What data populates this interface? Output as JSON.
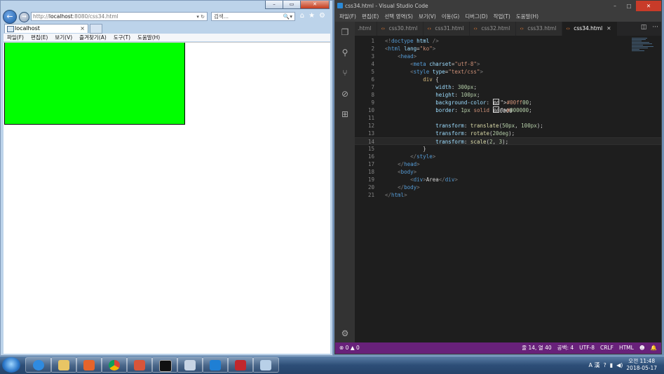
{
  "ie": {
    "address": {
      "prefix": "http://",
      "host": "localhost",
      "rest": ":8080/css34.html",
      "tools": "▾ ↻"
    },
    "search": {
      "placeholder": "검색...",
      "tools": "🔍▾"
    },
    "tab": {
      "label": "localhost",
      "close": "×"
    },
    "menu": [
      "파일(F)",
      "편집(E)",
      "보기(V)",
      "즐겨찾기(A)",
      "도구(T)",
      "도움말(H)"
    ],
    "content_box_color": "#00ff00"
  },
  "vscode": {
    "title": "css34.html - Visual Studio Code",
    "menu": [
      "파일(F)",
      "편집(E)",
      "선택 영역(S)",
      "보기(V)",
      "이동(G)",
      "디버그(D)",
      "작업(T)",
      "도움말(H)"
    ],
    "tabs": [
      {
        "label": ".html",
        "active": false
      },
      {
        "label": "css30.html",
        "active": false
      },
      {
        "label": "css31.html",
        "active": false
      },
      {
        "label": "css32.html",
        "active": false
      },
      {
        "label": "css33.html",
        "active": false
      },
      {
        "label": "css34.html",
        "active": true
      }
    ],
    "code_lines": [
      "<!doctype html />",
      "<html lang=\"ko\">",
      "    <head>",
      "        <meta charset=\"utf-8\">",
      "        <style type=\"text/css\">",
      "            div {",
      "                width: 300px;",
      "                height: 100px;",
      "                background-color: #00ff00;",
      "                border: 1px solid #000000;",
      "",
      "                transform: translate(50px, 100px);",
      "                transform: rotate(20deg);",
      "                transform: scale(2, 3);",
      "            }",
      "        </style>",
      "    </head>",
      "    <body>",
      "        <div>Area</div>",
      "    </body>",
      "</html>"
    ],
    "current_line": 14,
    "status": {
      "errors": "⊗ 0 ▲ 0",
      "position": "줄 14, 열 40",
      "spaces": "공백: 4",
      "encoding": "UTF-8",
      "eol": "CRLF",
      "language": "HTML"
    },
    "colors": {
      "status_bar": "#68217a",
      "editor_bg": "#1e1e1e"
    }
  },
  "taskbar": {
    "clock_time": "오전 11:48",
    "clock_date": "2018-05-17",
    "ime": "A 漢"
  }
}
